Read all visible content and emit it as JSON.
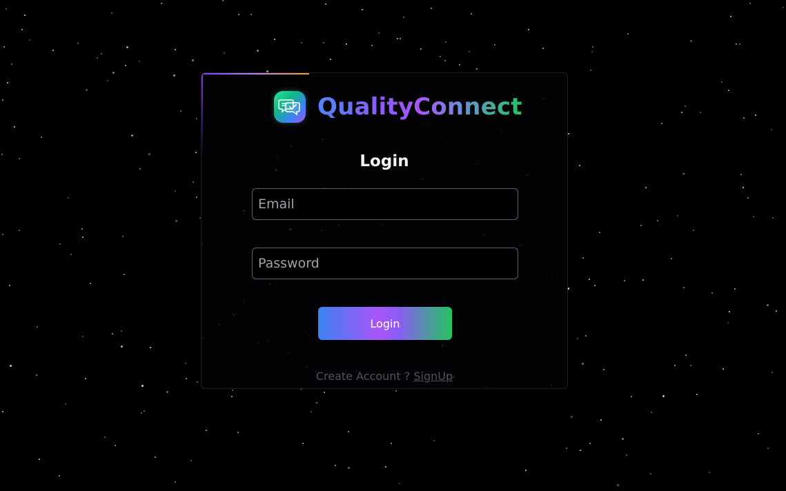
{
  "brand": {
    "name": "QualityConnect",
    "logo_icon": "chat-check-icon"
  },
  "form": {
    "title": "Login",
    "email_placeholder": "Email",
    "email_value": "",
    "password_placeholder": "Password",
    "password_value": "",
    "submit_label": "Login"
  },
  "footer": {
    "prompt": "Create Account ?",
    "signup_label": "SignUp"
  },
  "colors": {
    "background": "#000000",
    "gradient_start": "#3b82f6",
    "gradient_mid": "#a855f7",
    "gradient_end": "#22c55e"
  }
}
